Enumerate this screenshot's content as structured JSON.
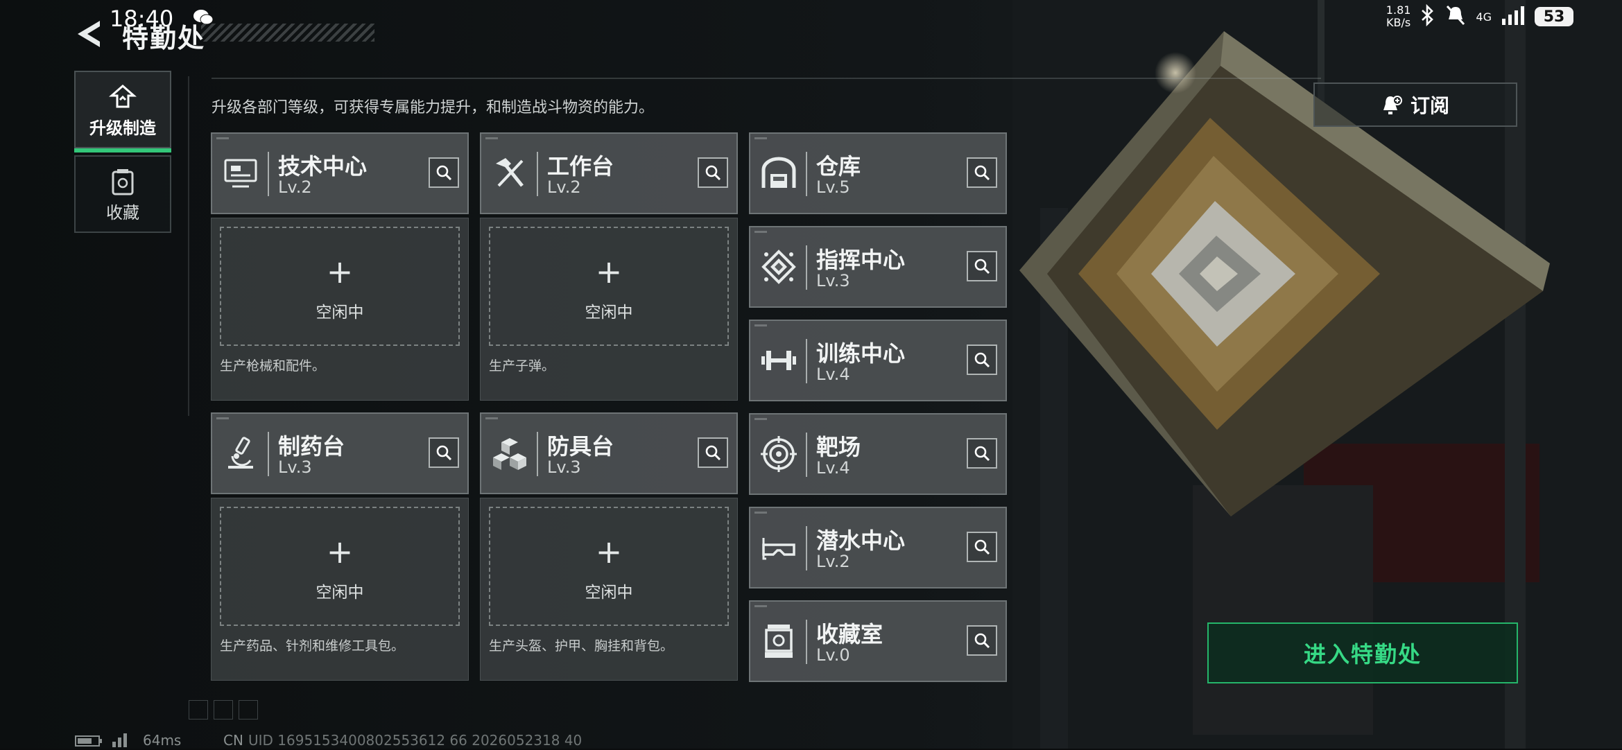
{
  "status_bar": {
    "time": "18:40",
    "speed_value": "1.81",
    "speed_unit": "KB/s",
    "network": "4G",
    "battery": "53"
  },
  "header": {
    "title": "特勤处"
  },
  "sidebar": {
    "items": [
      {
        "label": "升级制造"
      },
      {
        "label": "收藏"
      }
    ]
  },
  "main": {
    "subtitle": "升级各部门等级，可获得专属能力提升，和制造战斗物资的能力。",
    "idle_plus": "+",
    "idle_label": "空闲中",
    "production": [
      {
        "name": "技术中心",
        "level": "Lv.2",
        "desc": "生产枪械和配件。"
      },
      {
        "name": "工作台",
        "level": "Lv.2",
        "desc": "生产子弹。"
      },
      {
        "name": "制药台",
        "level": "Lv.3",
        "desc": "生产药品、针剂和维修工具包。"
      },
      {
        "name": "防具台",
        "level": "Lv.3",
        "desc": "生产头盔、护甲、胸挂和背包。"
      }
    ],
    "facilities": [
      {
        "name": "仓库",
        "level": "Lv.5"
      },
      {
        "name": "指挥中心",
        "level": "Lv.3"
      },
      {
        "name": "训练中心",
        "level": "Lv.4"
      },
      {
        "name": "靶场",
        "level": "Lv.4"
      },
      {
        "name": "潜水中心",
        "level": "Lv.2"
      },
      {
        "name": "收藏室",
        "level": "Lv.0"
      }
    ]
  },
  "actions": {
    "subscribe_label": "订阅",
    "enter_label": "进入特勤处"
  },
  "footer": {
    "ping": "64ms",
    "region": "CN",
    "uid": "UID 1695153400802553612 66 2026052318 40"
  },
  "colors": {
    "accent": "#33c779",
    "enter_text": "#36d985"
  }
}
